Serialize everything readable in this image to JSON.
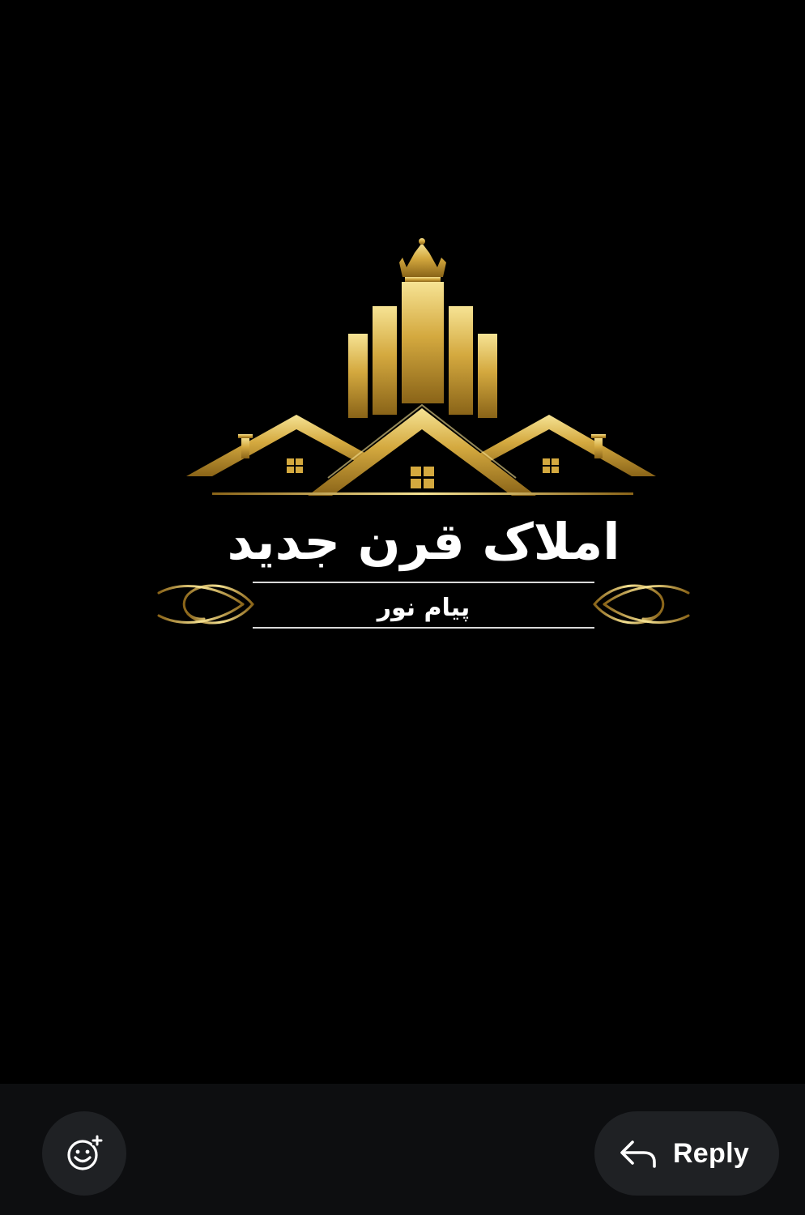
{
  "story": {
    "logo": {
      "title": "املاک قرن جدید",
      "subtitle": "پیام نور"
    }
  },
  "bottom_bar": {
    "react": {
      "icon": "emoji-add-icon"
    },
    "reply": {
      "label": "Reply",
      "icon": "reply-arrow-icon"
    }
  },
  "colors": {
    "background": "#000000",
    "gold": "#c9a03a",
    "gold_light": "#f3dc8c",
    "gold_dark": "#8a6418",
    "bar": "#0d0e10",
    "button": "#1f2124",
    "text": "#ffffff"
  }
}
